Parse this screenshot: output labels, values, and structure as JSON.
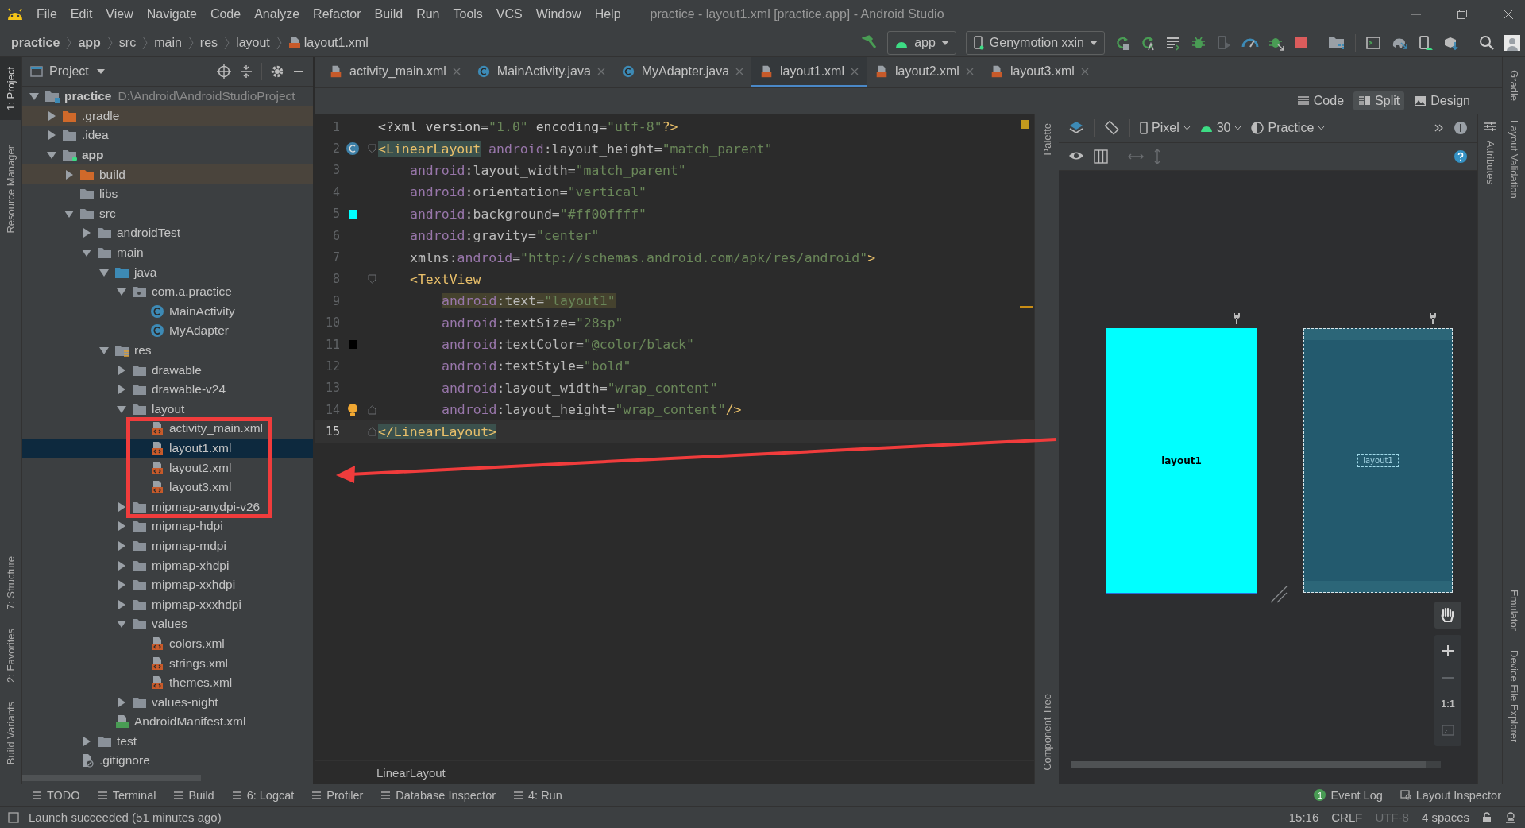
{
  "menu": [
    "File",
    "Edit",
    "View",
    "Navigate",
    "Code",
    "Analyze",
    "Refactor",
    "Build",
    "Run",
    "Tools",
    "VCS",
    "Window",
    "Help"
  ],
  "window_title": "practice - layout1.xml [practice.app] - Android Studio",
  "breadcrumbs": [
    {
      "label": "practice",
      "bold": true,
      "kind": "plain"
    },
    {
      "label": "app",
      "bold": true,
      "kind": "plain"
    },
    {
      "label": "src",
      "bold": false,
      "kind": "plain"
    },
    {
      "label": "main",
      "bold": false,
      "kind": "plain"
    },
    {
      "label": "res",
      "bold": false,
      "kind": "plain"
    },
    {
      "label": "layout",
      "bold": false,
      "kind": "plain"
    },
    {
      "label": "layout1.xml",
      "bold": false,
      "kind": "xml"
    }
  ],
  "toolbar": {
    "run_config": "app",
    "device": "Genymotion xxin"
  },
  "left_stripe_top": [
    {
      "label": "1: Project",
      "selected": true
    },
    {
      "label": "Resource Manager",
      "selected": false
    }
  ],
  "left_stripe_bottom": [
    {
      "label": "7: Structure",
      "selected": false
    },
    {
      "label": "2: Favorites",
      "selected": false
    },
    {
      "label": "Build Variants",
      "selected": false
    }
  ],
  "project_panel": {
    "title": "Project",
    "tree": [
      {
        "label": "practice",
        "kind": "module",
        "bold": true,
        "note": "D:\\Android\\AndroidStudioProject",
        "expanded": true,
        "selected": false,
        "children": [
          {
            "label": ".gradle",
            "kind": "excluded",
            "expanded": false,
            "selected": false
          },
          {
            "label": ".idea",
            "kind": "folder",
            "expanded": false,
            "selected": false
          },
          {
            "label": "app",
            "kind": "module",
            "bold": true,
            "expanded": true,
            "selected": false,
            "children": [
              {
                "label": "build",
                "kind": "excluded",
                "expanded": false,
                "selected": false
              },
              {
                "label": "libs",
                "kind": "folder",
                "selected": false
              },
              {
                "label": "src",
                "kind": "folder",
                "expanded": true,
                "selected": false,
                "children": [
                  {
                    "label": "androidTest",
                    "kind": "folder",
                    "expanded": false,
                    "selected": false
                  },
                  {
                    "label": "main",
                    "kind": "folder",
                    "expanded": true,
                    "selected": false,
                    "children": [
                      {
                        "label": "java",
                        "kind": "source",
                        "expanded": true,
                        "selected": false,
                        "children": [
                          {
                            "label": "com.a.practice",
                            "kind": "package",
                            "expanded": true,
                            "selected": false,
                            "children": [
                              {
                                "label": "MainActivity",
                                "kind": "class",
                                "selected": false
                              },
                              {
                                "label": "MyAdapter",
                                "kind": "class",
                                "selected": false
                              }
                            ]
                          }
                        ]
                      },
                      {
                        "label": "res",
                        "kind": "res",
                        "expanded": true,
                        "selected": false,
                        "children": [
                          {
                            "label": "drawable",
                            "kind": "folder",
                            "expanded": false,
                            "selected": false
                          },
                          {
                            "label": "drawable-v24",
                            "kind": "folder",
                            "expanded": false,
                            "selected": false
                          },
                          {
                            "label": "layout",
                            "kind": "folder",
                            "expanded": true,
                            "selected": false,
                            "children": [
                              {
                                "label": "activity_main.xml",
                                "kind": "xml",
                                "selected": false
                              },
                              {
                                "label": "layout1.xml",
                                "kind": "xml",
                                "selected": true
                              },
                              {
                                "label": "layout2.xml",
                                "kind": "xml",
                                "selected": false
                              },
                              {
                                "label": "layout3.xml",
                                "kind": "xml",
                                "selected": false
                              }
                            ]
                          },
                          {
                            "label": "mipmap-anydpi-v26",
                            "kind": "folder",
                            "expanded": false,
                            "selected": false
                          },
                          {
                            "label": "mipmap-hdpi",
                            "kind": "folder",
                            "expanded": false,
                            "selected": false
                          },
                          {
                            "label": "mipmap-mdpi",
                            "kind": "folder",
                            "expanded": false,
                            "selected": false
                          },
                          {
                            "label": "mipmap-xhdpi",
                            "kind": "folder",
                            "expanded": false,
                            "selected": false
                          },
                          {
                            "label": "mipmap-xxhdpi",
                            "kind": "folder",
                            "expanded": false,
                            "selected": false
                          },
                          {
                            "label": "mipmap-xxxhdpi",
                            "kind": "folder",
                            "expanded": false,
                            "selected": false
                          },
                          {
                            "label": "values",
                            "kind": "folder",
                            "expanded": true,
                            "selected": false,
                            "children": [
                              {
                                "label": "colors.xml",
                                "kind": "xml",
                                "selected": false
                              },
                              {
                                "label": "strings.xml",
                                "kind": "xml",
                                "selected": false
                              },
                              {
                                "label": "themes.xml",
                                "kind": "xml",
                                "selected": false
                              }
                            ]
                          },
                          {
                            "label": "values-night",
                            "kind": "folder",
                            "expanded": false,
                            "selected": false
                          }
                        ]
                      },
                      {
                        "label": "AndroidManifest.xml",
                        "kind": "manifest",
                        "selected": false
                      }
                    ]
                  },
                  {
                    "label": "test",
                    "kind": "folder",
                    "expanded": false,
                    "selected": false
                  }
                ]
              },
              {
                "label": ".gitignore",
                "kind": "gitignore",
                "selected": false
              }
            ]
          }
        ]
      }
    ]
  },
  "editor_tabs": [
    {
      "label": "activity_main.xml",
      "kind": "xml",
      "selected": false
    },
    {
      "label": "MainActivity.java",
      "kind": "class",
      "selected": false
    },
    {
      "label": "MyAdapter.java",
      "kind": "class",
      "selected": false
    },
    {
      "label": "layout1.xml",
      "kind": "xml",
      "selected": true
    },
    {
      "label": "layout2.xml",
      "kind": "xml",
      "selected": false
    },
    {
      "label": "layout3.xml",
      "kind": "xml",
      "selected": false
    }
  ],
  "code_lines": [
    {
      "number": "1",
      "kind": "root",
      "current": false,
      "tokens": [
        {
          "t": "<?xml version=",
          "kind": "plain"
        },
        {
          "t": "\"1.0\"",
          "kind": "val"
        },
        {
          "t": " encoding=",
          "kind": "plain"
        },
        {
          "t": "\"utf-8\"",
          "kind": "val"
        },
        {
          "t": "?>",
          "kind": "tag"
        }
      ]
    },
    {
      "number": "2",
      "kind": "root",
      "gutter": {
        "kind": "class"
      },
      "fold": {
        "kind": "start"
      },
      "current": false,
      "tokens": [
        {
          "t": "<LinearLayout",
          "kind": "tag-match"
        },
        {
          "t": " android",
          "kind": "ns"
        },
        {
          "t": ":layout_height=",
          "kind": "attr"
        },
        {
          "t": "\"match_parent\"",
          "kind": "val"
        }
      ]
    },
    {
      "number": "3",
      "kind": "attribute",
      "current": false,
      "tokens": [
        {
          "t": "android",
          "kind": "ns"
        },
        {
          "t": ":layout_width=",
          "kind": "attr"
        },
        {
          "t": "\"match_parent\"",
          "kind": "val"
        }
      ]
    },
    {
      "number": "4",
      "kind": "attribute",
      "current": false,
      "tokens": [
        {
          "t": "android",
          "kind": "ns"
        },
        {
          "t": ":orientation=",
          "kind": "attr"
        },
        {
          "t": "\"vertical\"",
          "kind": "val"
        }
      ]
    },
    {
      "number": "5",
      "kind": "attribute",
      "gutter": {
        "kind": "swatch",
        "color": "#00ffff"
      },
      "current": false,
      "tokens": [
        {
          "t": "android",
          "kind": "ns"
        },
        {
          "t": ":background=",
          "kind": "attr"
        },
        {
          "t": "\"#ff00ffff\"",
          "kind": "val"
        }
      ]
    },
    {
      "number": "6",
      "kind": "attribute",
      "current": false,
      "tokens": [
        {
          "t": "android",
          "kind": "ns"
        },
        {
          "t": ":gravity=",
          "kind": "attr"
        },
        {
          "t": "\"center\"",
          "kind": "val"
        }
      ]
    },
    {
      "number": "7",
      "kind": "attribute",
      "current": false,
      "tokens": [
        {
          "t": "xmlns:",
          "kind": "attr"
        },
        {
          "t": "android",
          "kind": "ns"
        },
        {
          "t": "=",
          "kind": "attr"
        },
        {
          "t": "\"http://schemas.android.com/apk/res/android\"",
          "kind": "val"
        },
        {
          "t": ">",
          "kind": "tag"
        }
      ]
    },
    {
      "number": "8",
      "kind": "attribute",
      "fold": {
        "kind": "start"
      },
      "current": false,
      "tokens": [
        {
          "t": "<TextView",
          "kind": "tag"
        }
      ]
    },
    {
      "number": "9",
      "kind": "child-attribute",
      "current": false,
      "tokens": [
        {
          "t": "android",
          "kind": "ns-match"
        },
        {
          "t": ":text=",
          "kind": "attr-match"
        },
        {
          "t": "\"layout1\"",
          "kind": "val-match"
        }
      ]
    },
    {
      "number": "10",
      "kind": "child-attribute",
      "current": false,
      "tokens": [
        {
          "t": "android",
          "kind": "ns"
        },
        {
          "t": ":textSize=",
          "kind": "attr"
        },
        {
          "t": "\"28sp\"",
          "kind": "val"
        }
      ]
    },
    {
      "number": "11",
      "kind": "child-attribute",
      "gutter": {
        "kind": "swatch",
        "color": "#000000"
      },
      "current": false,
      "tokens": [
        {
          "t": "android",
          "kind": "ns"
        },
        {
          "t": ":textColor=",
          "kind": "attr"
        },
        {
          "t": "\"@color/black\"",
          "kind": "val"
        }
      ]
    },
    {
      "number": "12",
      "kind": "child-attribute",
      "current": false,
      "tokens": [
        {
          "t": "android",
          "kind": "ns"
        },
        {
          "t": ":textStyle=",
          "kind": "attr"
        },
        {
          "t": "\"bold\"",
          "kind": "val"
        }
      ]
    },
    {
      "number": "13",
      "kind": "child-attribute",
      "current": false,
      "tokens": [
        {
          "t": "android",
          "kind": "ns"
        },
        {
          "t": ":layout_width=",
          "kind": "attr"
        },
        {
          "t": "\"wrap_content\"",
          "kind": "val"
        }
      ]
    },
    {
      "number": "14",
      "kind": "child-attribute",
      "gutter": {
        "kind": "bulb"
      },
      "fold": {
        "kind": "end"
      },
      "current": false,
      "tokens": [
        {
          "t": "android",
          "kind": "ns"
        },
        {
          "t": ":layout_height=",
          "kind": "attr"
        },
        {
          "t": "\"wrap_content\"",
          "kind": "val"
        },
        {
          "t": "/>",
          "kind": "tag"
        }
      ]
    },
    {
      "number": "15",
      "kind": "root",
      "fold": {
        "kind": "end"
      },
      "current": true,
      "tokens": [
        {
          "t": "</LinearLayout>",
          "kind": "tag-match"
        }
      ]
    }
  ],
  "editor_breadcrumb": "LinearLayout",
  "design": {
    "modes": [
      {
        "label": "Code",
        "selected": false
      },
      {
        "label": "Split",
        "selected": true
      },
      {
        "label": "Design",
        "selected": false
      }
    ],
    "device": "Pixel",
    "api": "30",
    "theme": "Practice",
    "preview_text": "layout1",
    "blueprint_text": "layout1",
    "zoom_label": "1:1",
    "palette_label": "Palette",
    "component_tree_label": "Component Tree",
    "attributes_label": "Attributes"
  },
  "right_stripe_top": [
    "Gradle",
    "Layout Validation"
  ],
  "right_stripe_bottom": [
    "Emulator",
    "Device File Explorer"
  ],
  "tool_windows_left": [
    "TODO",
    "Terminal",
    "Build",
    "6: Logcat",
    "Profiler",
    "Database Inspector",
    "4: Run"
  ],
  "tool_windows_right": [
    {
      "label": "Event Log",
      "badge": "1"
    },
    {
      "label": "Layout Inspector"
    }
  ],
  "status": {
    "message": "Launch succeeded (51 minutes ago)",
    "items": [
      {
        "label": "15:16",
        "disabled": false
      },
      {
        "label": "CRLF",
        "disabled": false
      },
      {
        "label": "UTF-8",
        "disabled": true
      },
      {
        "label": "4 spaces",
        "disabled": false
      }
    ]
  }
}
